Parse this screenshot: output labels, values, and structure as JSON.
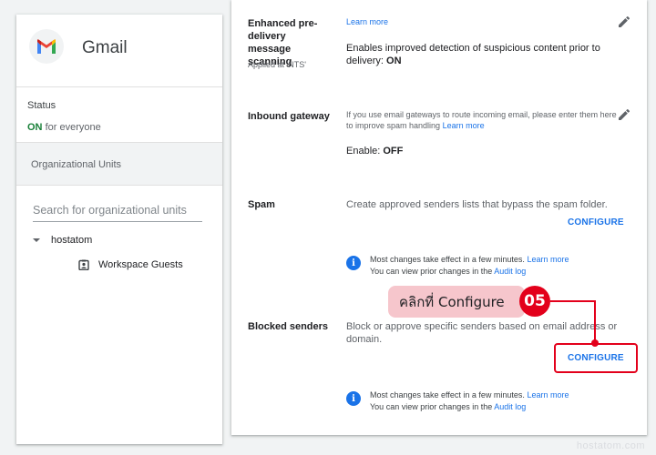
{
  "app": {
    "name": "Gmail",
    "icon": "gmail-logo-icon"
  },
  "status": {
    "label": "Status",
    "on": "ON",
    "scope": "for everyone"
  },
  "org_units": {
    "label": "Organizational Units",
    "search_placeholder": "Search for organizational units",
    "root": "hostatom",
    "child": "Workspace Guests"
  },
  "settings": {
    "enhanced": {
      "title": "Enhanced pre-delivery message scanning",
      "applied_at": "Applied at 'NTS'",
      "learn_more": "Learn more",
      "description": "Enables improved detection of suspicious content prior to delivery:",
      "value": "ON"
    },
    "inbound": {
      "title": "Inbound gateway",
      "description": "If you use email gateways to route incoming email, please enter them here to improve spam handling",
      "learn_more": "Learn more",
      "enable_label": "Enable:",
      "enable_value": "OFF"
    },
    "spam": {
      "title": "Spam",
      "description": "Create approved senders lists that bypass the spam folder.",
      "configure": "CONFIGURE",
      "info_line1": "Most changes take effect in a few minutes.",
      "info_learn_more": "Learn more",
      "info_line2": "You can view prior changes in the",
      "audit_log": "Audit log"
    },
    "blocked": {
      "title": "Blocked senders",
      "description": "Block or approve specific senders based on email address or domain.",
      "configure": "CONFIGURE",
      "info_line1": "Most changes take effect in a few minutes.",
      "info_learn_more": "Learn more",
      "info_line2": "You can view prior changes in the",
      "audit_log": "Audit log"
    }
  },
  "annotation": {
    "callout": "คลิกที่ Configure",
    "step": "05",
    "color": "#e3001b"
  },
  "watermark": "hostatom.com"
}
